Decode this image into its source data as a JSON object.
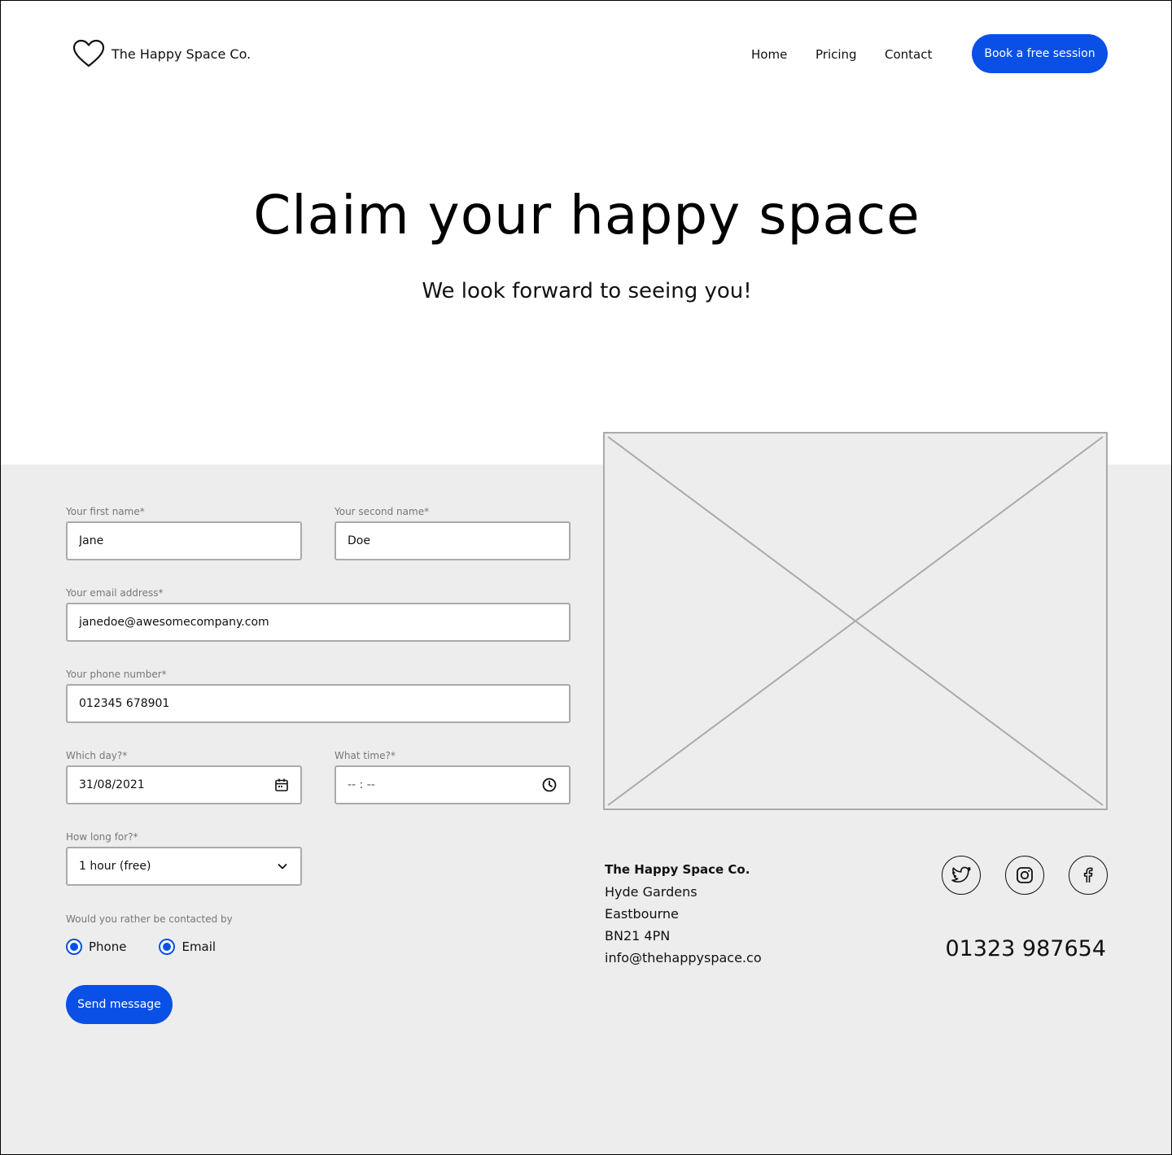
{
  "header": {
    "brand": "The Happy Space Co.",
    "nav": [
      "Home",
      "Pricing",
      "Contact"
    ],
    "cta_label": "Book a free session"
  },
  "hero": {
    "title": "Claim your happy space",
    "subtitle": "We look forward to seeing you!"
  },
  "form": {
    "first_name": {
      "label": "Your first name*",
      "value": "Jane"
    },
    "second_name": {
      "label": "Your second name*",
      "value": "Doe"
    },
    "email": {
      "label": "Your email address*",
      "value": "janedoe@awesomecompany.com"
    },
    "phone": {
      "label": "Your phone number*",
      "value": "012345 678901"
    },
    "day": {
      "label": "Which day?*",
      "value": "31/08/2021",
      "icon": "calendar-icon"
    },
    "time": {
      "label": "What time?*",
      "placeholder": "-- : --",
      "icon": "clock-icon"
    },
    "duration": {
      "label": "How long for?*",
      "value": "1 hour (free)",
      "icon": "chevron-down-icon"
    },
    "contact_pref": {
      "label": "Would you rather be contacted by",
      "options": [
        "Phone",
        "Email"
      ]
    },
    "submit_label": "Send message"
  },
  "contact_info": {
    "company": "The Happy Space Co.",
    "address_lines": [
      "Hyde Gardens",
      "Eastbourne",
      "BN21 4PN"
    ],
    "email": "info@thehappyspace.co",
    "phone": "01323 987654",
    "socials": [
      "twitter-icon",
      "instagram-icon",
      "facebook-icon"
    ]
  },
  "colors": {
    "accent": "#0a50e6",
    "section_bg": "#ededed",
    "border": "#aaaaaa",
    "label": "#777777"
  }
}
